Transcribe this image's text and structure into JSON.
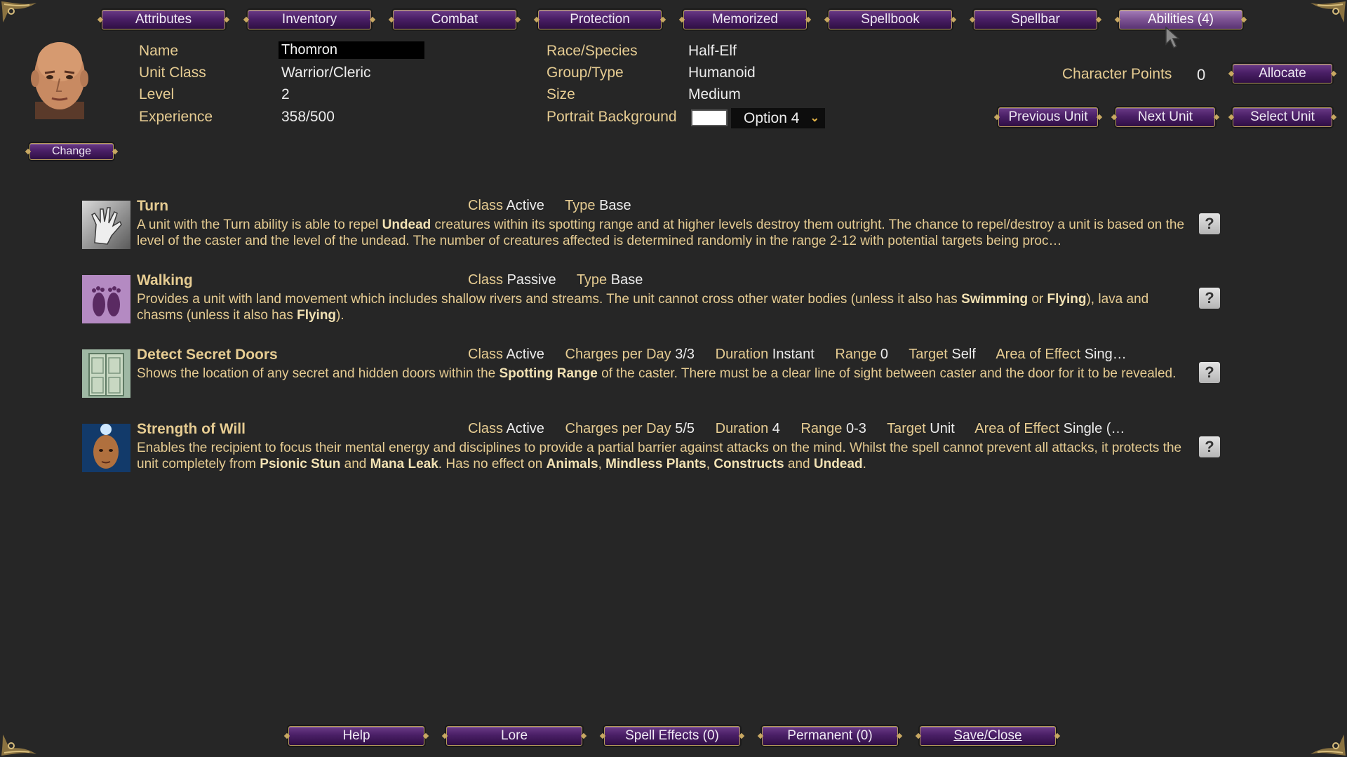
{
  "tabs": [
    {
      "label": "Attributes",
      "active": false
    },
    {
      "label": "Inventory",
      "active": false
    },
    {
      "label": "Combat",
      "active": false
    },
    {
      "label": "Protection",
      "active": false
    },
    {
      "label": "Memorized",
      "active": false
    },
    {
      "label": "Spellbook",
      "active": false
    },
    {
      "label": "Spellbar",
      "active": false
    },
    {
      "label": "Abilities (4)",
      "active": true
    }
  ],
  "portrait": {
    "change_label": "Change"
  },
  "unit": {
    "name_label": "Name",
    "name_value": "Thomron",
    "class_label": "Unit Class",
    "class_value": "Warrior/Cleric",
    "level_label": "Level",
    "level_value": "2",
    "exp_label": "Experience",
    "exp_value": "358/500",
    "race_label": "Race/Species",
    "race_value": "Half-Elf",
    "group_label": "Group/Type",
    "group_value": "Humanoid",
    "size_label": "Size",
    "size_value": "Medium",
    "bg_label": "Portrait Background",
    "bg_value": "Option 4",
    "bg_color": "#ffffff"
  },
  "points": {
    "label": "Character Points",
    "value": "0",
    "allocate_label": "Allocate"
  },
  "nav": {
    "prev": "Previous Unit",
    "next": "Next Unit",
    "select": "Select Unit"
  },
  "abilities": [
    {
      "name": "Turn",
      "icon": "turn-hand-icon",
      "class_key": "Class",
      "class_val": "Active",
      "type_key": "Type",
      "type_val": "Base",
      "desc_1": "A unit with the Turn ability is able to repel ",
      "desc_b1": "Undead",
      "desc_2": " creatures within its spotting range and at higher levels destroy them outright. The chance to repel/destroy a unit is based on the level of the caster and the level of the undead. The number of creatures affected is determined randomly in the range 2-12 with potential targets being proc…"
    },
    {
      "name": "Walking",
      "icon": "footprints-icon",
      "class_key": "Class",
      "class_val": "Passive",
      "type_key": "Type",
      "type_val": "Base",
      "desc_1": "Provides a unit with land movement which includes shallow rivers and streams. The unit cannot cross other water bodies (unless it also has ",
      "desc_b1": "Swimming",
      "desc_2": " or ",
      "desc_b2": "Flying",
      "desc_3": "), lava and chasms (unless it also has ",
      "desc_b3": "Flying",
      "desc_4": ")."
    },
    {
      "name": "Detect Secret Doors",
      "icon": "secret-door-icon",
      "class_key": "Class",
      "class_val": "Active",
      "charges_key": "Charges per Day",
      "charges_val": "3/3",
      "duration_key": "Duration",
      "duration_val": "Instant",
      "range_key": "Range",
      "range_val": "0",
      "target_key": "Target",
      "target_val": "Self",
      "aoe_key": "Area of Effect",
      "aoe_val": "Sing…",
      "desc_1": "Shows the location of any secret and hidden doors within the ",
      "desc_b1": "Spotting Range",
      "desc_2": " of the caster. There must be a clear line of sight between caster and the door for it to be revealed."
    },
    {
      "name": "Strength of Will",
      "icon": "glowing-head-icon",
      "class_key": "Class",
      "class_val": "Active",
      "charges_key": "Charges per Day",
      "charges_val": "5/5",
      "duration_key": "Duration",
      "duration_val": "4",
      "range_key": "Range",
      "range_val": "0-3",
      "target_key": "Target",
      "target_val": "Unit",
      "aoe_key": "Area of Effect",
      "aoe_val": "Single (…",
      "desc_1": "Enables the recipient to focus their mental energy and disciplines to provide a partial barrier against attacks on the mind. Whilst the spell cannot prevent all attacks, it protects the unit completely from ",
      "desc_b1": "Psionic Stun",
      "desc_2": " and ",
      "desc_b2": "Mana Leak",
      "desc_3": ". Has no effect on ",
      "desc_b3": "Animals",
      "desc_4": ", ",
      "desc_b4": "Mindless Plants",
      "desc_5": ", ",
      "desc_b5": "Constructs",
      "desc_6": " and ",
      "desc_b6": "Undead",
      "desc_7": "."
    }
  ],
  "help_glyph": "?",
  "bottom": {
    "help": "Help",
    "lore": "Lore",
    "effects": "Spell Effects (0)",
    "permanent": "Permanent (0)",
    "save": "Save/Close"
  },
  "colors": {
    "accent_gold": "#e6cc92",
    "button_purple": "#4a1f66",
    "active_tab": "#7c5292",
    "background": "#262626"
  }
}
